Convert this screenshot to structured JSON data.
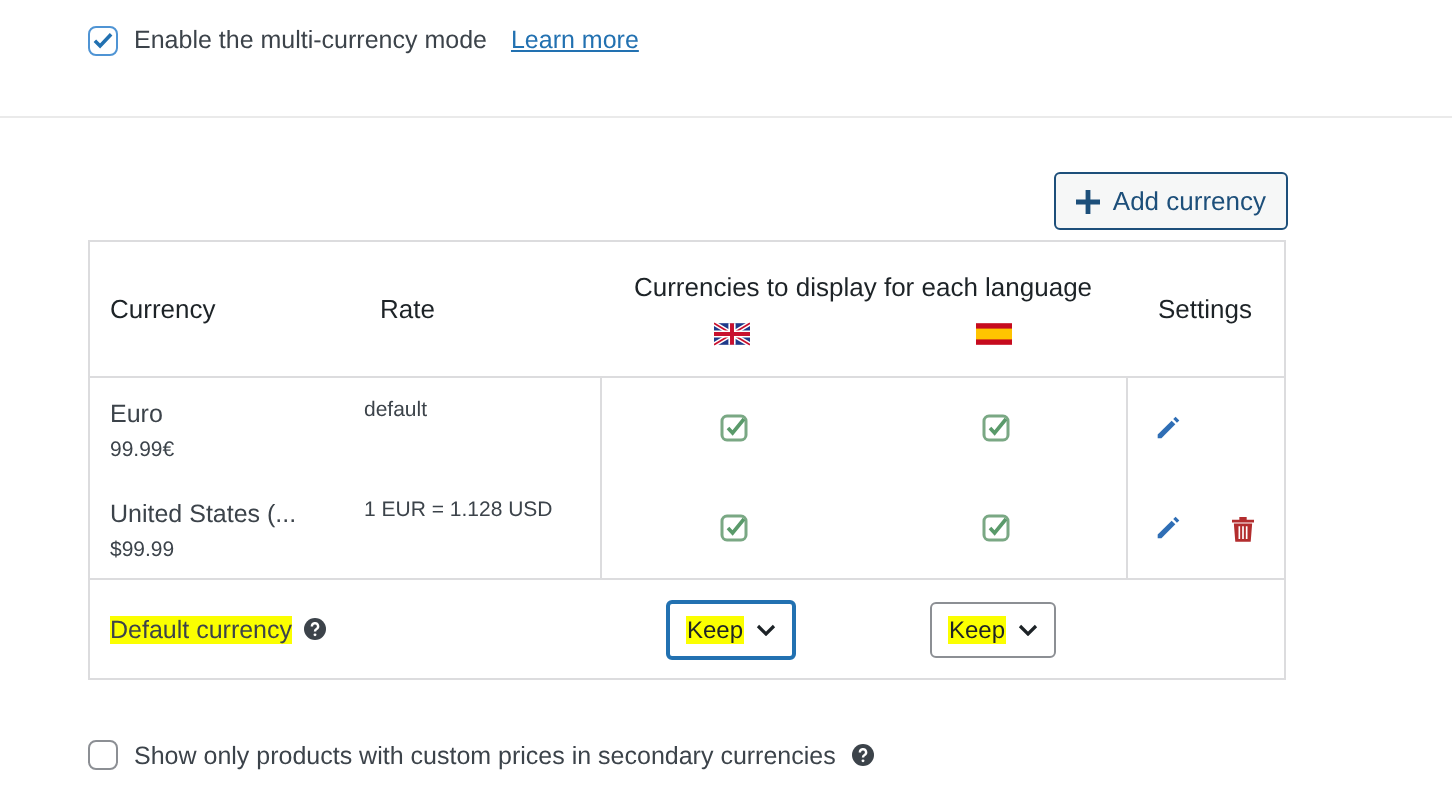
{
  "multi_currency": {
    "label": "Enable the multi-currency mode",
    "checked": true,
    "link": "Learn more"
  },
  "add_button": {
    "label": "Add currency"
  },
  "table": {
    "columns": [
      "Currency",
      "Rate"
    ],
    "languages_header": "Currencies to display for each language",
    "languages": [
      {
        "kind": "uk"
      },
      {
        "kind": "es"
      }
    ],
    "settings_header": "Settings",
    "rows": [
      {
        "name": "Euro",
        "price": "99.99€",
        "rate": "default",
        "displays": [
          {
            "checked": true
          },
          {
            "checked": true
          }
        ],
        "deletable": false
      },
      {
        "name": "United States (...",
        "price": "$99.99",
        "rate": "1 EUR = 1.128 USD",
        "displays": [
          {
            "checked": true
          },
          {
            "checked": true
          }
        ],
        "deletable": true
      }
    ],
    "footer": {
      "label": "Default currency",
      "highlighted": true,
      "selects": [
        {
          "value": "Keep",
          "focused": true,
          "highlighted": true
        },
        {
          "value": "Keep",
          "focused": false,
          "highlighted": true
        }
      ]
    }
  },
  "custom_prices": {
    "label": "Show only products with custom prices in secondary currencies",
    "checked": false
  }
}
